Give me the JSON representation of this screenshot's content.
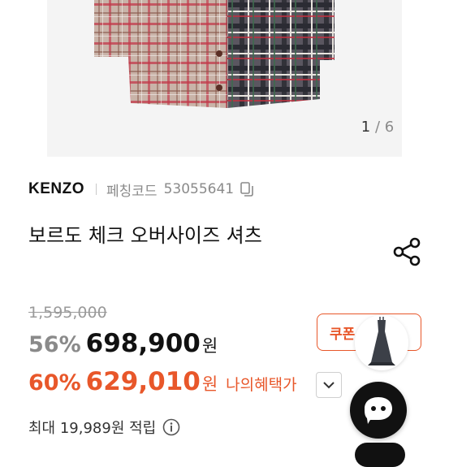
{
  "gallery": {
    "current": "1",
    "separator": "/",
    "total": "6"
  },
  "product": {
    "brand": "KENZO",
    "code_label": "페칭코드",
    "code_value": "53055641",
    "title": "보르도 체크 오버사이즈 셔츠"
  },
  "pricing": {
    "original": "1,595,000",
    "discount_percent": "56%",
    "sale_price": "698,900",
    "currency": "원",
    "my_percent": "60%",
    "my_price": "629,010",
    "my_benefit_label": "나의혜택가",
    "points_text": "최대 19,989원 적립"
  },
  "coupon": {
    "label": "쿠폰"
  },
  "colors": {
    "accent": "#e8572a",
    "text": "#111111",
    "muted": "#8a8a8a",
    "fab": "#111111"
  }
}
